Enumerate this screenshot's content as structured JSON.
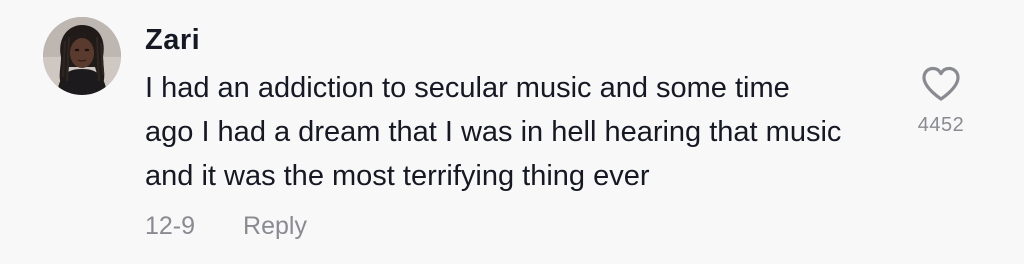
{
  "comment": {
    "username": "Zari",
    "text_lines": [
      "I had an addiction to secular music and some time",
      "ago I had a dream that I was in hell hearing that music",
      "and it was the most terrifying thing ever"
    ],
    "date": "12-9",
    "reply_label": "Reply",
    "like_count": "4452",
    "like_icon": "heart-outline-icon"
  },
  "colors": {
    "background": "#f8f8f8",
    "text_primary": "#161823",
    "text_secondary": "#8a8b91"
  }
}
